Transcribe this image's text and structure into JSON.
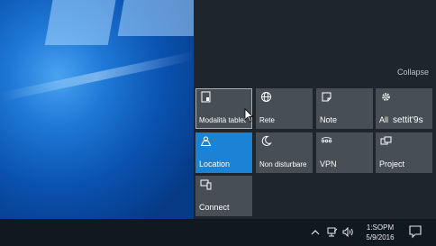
{
  "action_center": {
    "collapse_label": "Collapse",
    "tiles": [
      {
        "label": "Modalità tablet",
        "icon": "tablet-mode-icon",
        "state": "hover"
      },
      {
        "label": "Rete",
        "icon": "globe-network-icon"
      },
      {
        "label": "Note",
        "icon": "note-icon"
      },
      {
        "label": "All",
        "icon": "gear-icon",
        "overlay_text": "settit'9s"
      },
      {
        "label": "Location",
        "icon": "location-icon",
        "state": "active"
      },
      {
        "label": "Non disturbare",
        "icon": "moon-icon"
      },
      {
        "label": "VPN",
        "icon": "vpn-icon"
      },
      {
        "label": "Project",
        "icon": "project-icon"
      },
      {
        "label": "Connect",
        "icon": "connect-icon"
      }
    ]
  },
  "taskbar": {
    "clock_time": "1:SOPM",
    "clock_date": "5/9/2016"
  },
  "colors": {
    "panel_bg": "#1f262b",
    "tile_bg": "#474e54",
    "tile_active": "#1a83d6",
    "taskbar_bg": "#101820"
  }
}
